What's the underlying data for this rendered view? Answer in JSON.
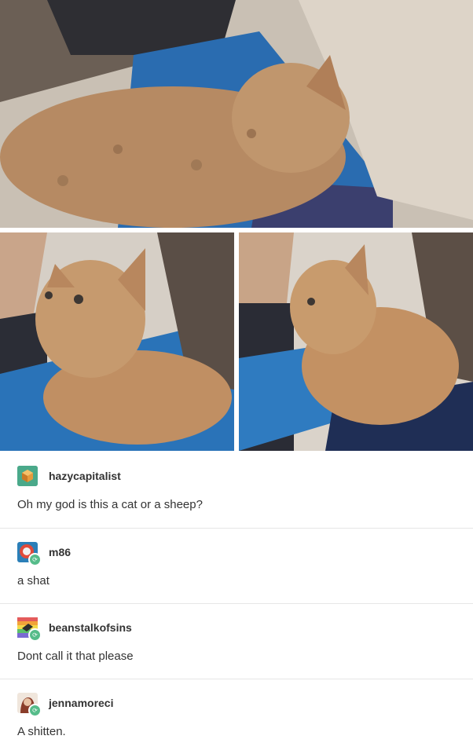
{
  "photos": {
    "top": {
      "icon": "curly-kitten-photo"
    },
    "left": {
      "icon": "curly-kitten-photo"
    },
    "right": {
      "icon": "curly-kitten-photo"
    }
  },
  "posts": [
    {
      "username": "hazycapitalist",
      "message": "Oh my god is this a cat or a sheep?",
      "avatar_color": "#3b9c7a",
      "reblog": false
    },
    {
      "username": "m86",
      "message": "a shat",
      "avatar_color": "#2b7fb8",
      "reblog": true
    },
    {
      "username": "beanstalkofsins",
      "message": "Dont call it that please",
      "avatar_color": "#e8a54a",
      "reblog": true
    },
    {
      "username": "jennamoreci",
      "message": "A shitten.",
      "avatar_color": "#c97a5a",
      "reblog": true
    }
  ],
  "colors": {
    "reblog_badge": "#56bc8a",
    "divider": "#e6e6e6"
  }
}
